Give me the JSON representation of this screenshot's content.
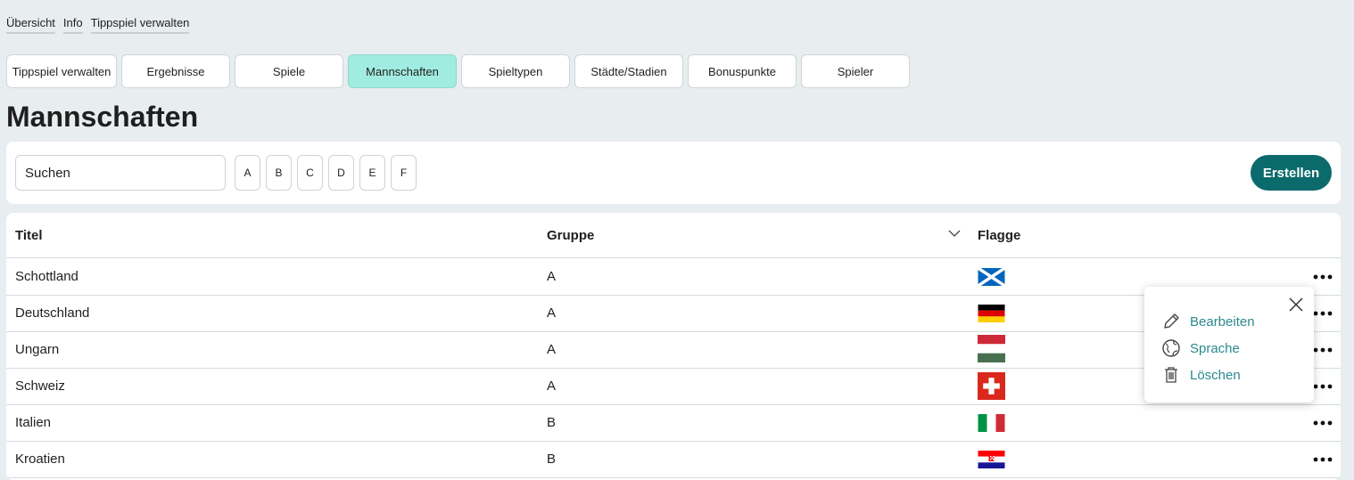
{
  "breadcrumb": [
    "Übersicht",
    "Info",
    "Tippspiel verwalten"
  ],
  "tabs": [
    {
      "label": "Tippspiel verwalten",
      "active": false
    },
    {
      "label": "Ergebnisse",
      "active": false
    },
    {
      "label": "Spiele",
      "active": false
    },
    {
      "label": "Mannschaften",
      "active": true
    },
    {
      "label": "Spieltypen",
      "active": false
    },
    {
      "label": "Städte/Stadien",
      "active": false
    },
    {
      "label": "Bonuspunkte",
      "active": false
    },
    {
      "label": "Spieler",
      "active": false
    }
  ],
  "page_title": "Mannschaften",
  "toolbar": {
    "search_placeholder": "Suchen",
    "letters": [
      "A",
      "B",
      "C",
      "D",
      "E",
      "F"
    ],
    "create_label": "Erstellen"
  },
  "table": {
    "columns": {
      "title": "Titel",
      "group": "Gruppe",
      "flag": "Flagge"
    },
    "rows": [
      {
        "title": "Schottland",
        "group": "A",
        "flag_icon": "flag-scotland-icon"
      },
      {
        "title": "Deutschland",
        "group": "A",
        "flag_icon": "flag-germany-icon"
      },
      {
        "title": "Ungarn",
        "group": "A",
        "flag_icon": "flag-hungary-icon"
      },
      {
        "title": "Schweiz",
        "group": "A",
        "flag_icon": "flag-switzerland-icon"
      },
      {
        "title": "Italien",
        "group": "B",
        "flag_icon": "flag-italy-icon"
      },
      {
        "title": "Kroatien",
        "group": "B",
        "flag_icon": "flag-croatia-icon"
      }
    ]
  },
  "context_menu": {
    "items": [
      {
        "label": "Bearbeiten",
        "icon": "pencil-icon"
      },
      {
        "label": "Sprache",
        "icon": "globe-icon"
      },
      {
        "label": "Löschen",
        "icon": "trash-icon"
      }
    ]
  },
  "colors": {
    "accent": "#0b6a6b",
    "active_tab": "#a1ece0",
    "menu_link": "#2b8a8e",
    "background": "#e8edef"
  }
}
